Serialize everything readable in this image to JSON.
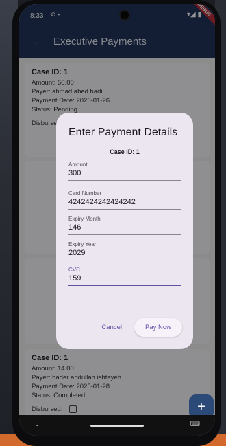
{
  "status_bar": {
    "time": "8:33",
    "debug_banner": "DEBUG"
  },
  "app_bar": {
    "title": "Executive Payments"
  },
  "cards": [
    {
      "case_id": "Case ID: 1",
      "amount": "Amount: 50.00",
      "payer": "Payer: ahmad abed hadi",
      "payment_date": "Payment Date: 2025-01-26",
      "status": "Status: Pending",
      "disbursed_label": "Disbursed:"
    },
    {
      "case_id": "Case ID: 1",
      "amount": "Amount: 14.00",
      "payer": "Payer: bader abdullah ishtayeh",
      "payment_date": "Payment Date: 2025-01-28",
      "status": "Status: Completed",
      "disbursed_label": "Disbursed:"
    }
  ],
  "dialog": {
    "title": "Enter Payment Details",
    "case_id": "Case ID: 1",
    "fields": [
      {
        "label": "Amount",
        "value": "300"
      },
      {
        "label": "Card Number",
        "value": "4242424242424242"
      },
      {
        "label": "Expiry Month",
        "value": "146"
      },
      {
        "label": "Expiry Year",
        "value": "2029"
      },
      {
        "label": "CVC",
        "value": "159"
      }
    ],
    "cancel_label": "Cancel",
    "pay_label": "Pay Now"
  },
  "fab": {
    "label": "+"
  },
  "icons": {
    "back": "arrow-left-icon",
    "wifi": "wifi-icon",
    "battery": "battery-icon",
    "add": "plus-icon",
    "keyboard": "keyboard-icon",
    "chevron": "chevron-down-icon"
  },
  "colors": {
    "app_bar": "#22355a",
    "accent": "#6750a4",
    "dialog_bg": "#ece6f0"
  }
}
